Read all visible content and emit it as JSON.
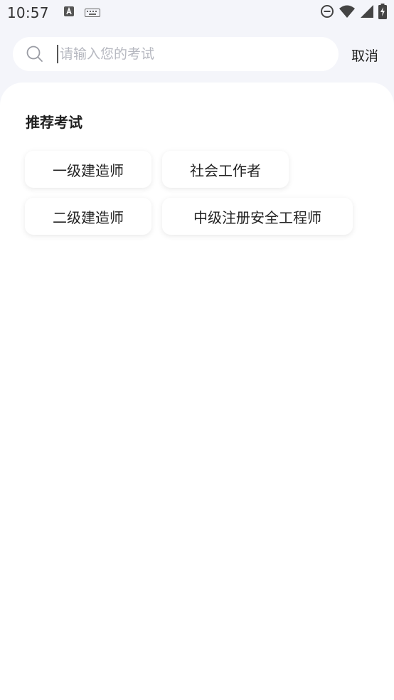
{
  "status_bar": {
    "time": "10:57",
    "left_icons": [
      "font-a-icon",
      "keyboard-icon"
    ],
    "right_icons": [
      "do-not-disturb-icon",
      "wifi-icon",
      "cellular-signal-icon",
      "battery-charging-icon"
    ]
  },
  "search": {
    "placeholder": "请输入您的考试",
    "value": "",
    "cancel_label": "取消"
  },
  "recommend": {
    "title": "推荐考试",
    "exams": [
      {
        "label": "一级建造师"
      },
      {
        "label": "社会工作者"
      },
      {
        "label": "二级建造师"
      },
      {
        "label": "中级注册安全工程师"
      }
    ]
  },
  "colors": {
    "page_background": "#f4f5fa",
    "panel_background": "#ffffff",
    "placeholder_text": "#b6b8c0",
    "primary_text": "#222222"
  }
}
